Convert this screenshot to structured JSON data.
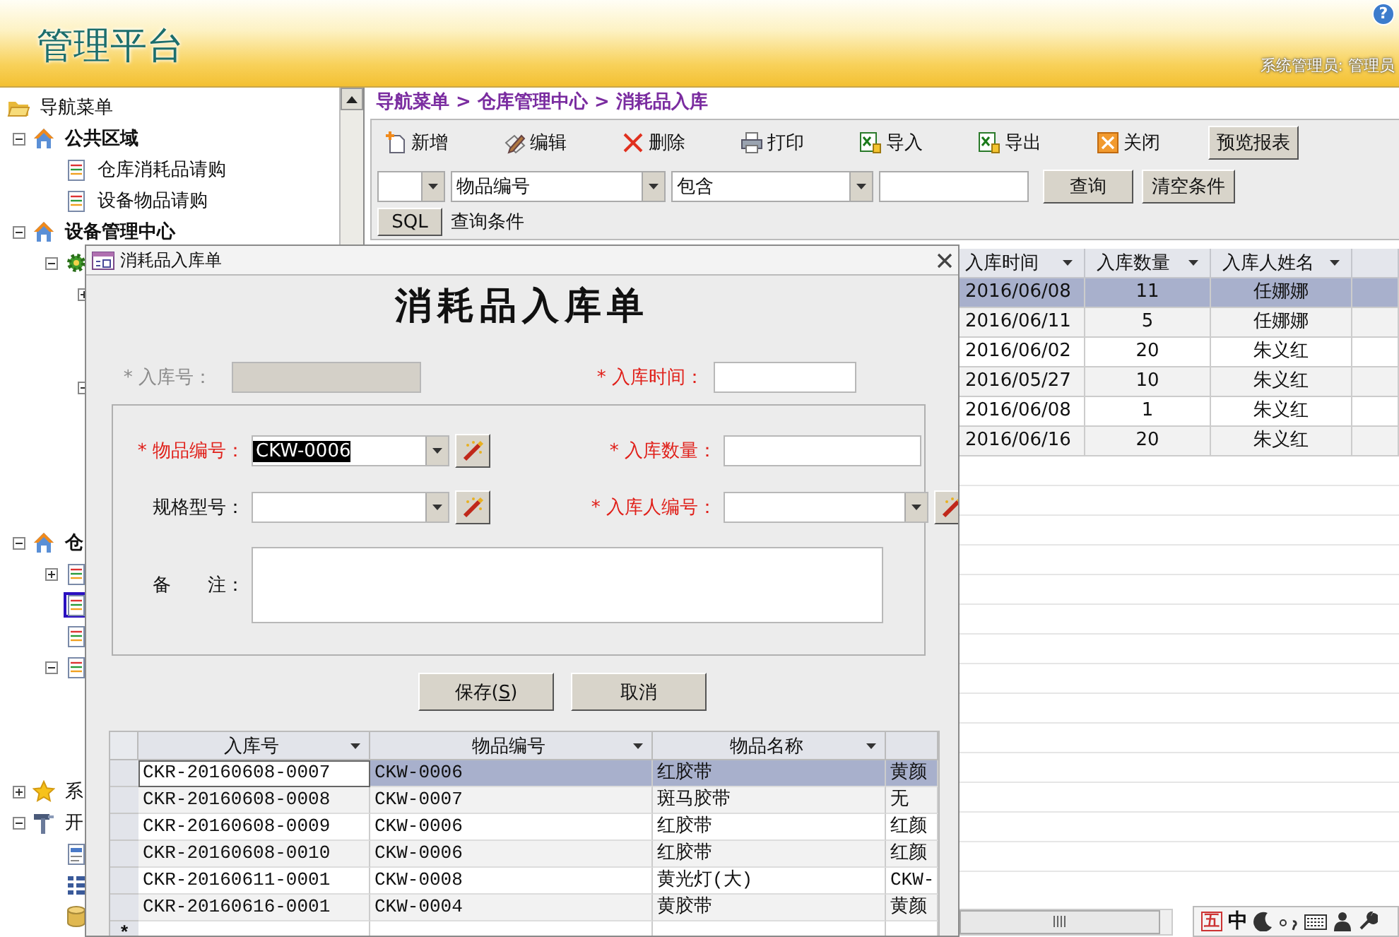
{
  "header": {
    "title": "管理平台",
    "user": "系统管理员: 管理员",
    "help": "?"
  },
  "nav_tree": {
    "root": {
      "label": "导航菜单",
      "kind": "folder",
      "selected": false,
      "children": [
        {
          "label": "公共区域",
          "kind": "area",
          "expanded": true,
          "selected": false,
          "children": [
            {
              "label": "仓库消耗品请购",
              "kind": "page",
              "selected": false
            },
            {
              "label": "设备物品请购",
              "kind": "page",
              "selected": false
            }
          ]
        },
        {
          "label": "设备管理中心",
          "kind": "area",
          "expanded": true,
          "selected": false,
          "children": [
            {
              "kind": "module",
              "expanded": true,
              "selected": false,
              "children": [
                {
                  "expanded": false,
                  "selected": false
                },
                {
                  "expanded": true,
                  "selected": false
                }
              ]
            }
          ]
        },
        {
          "label": "仓",
          "kind": "area",
          "expanded": true,
          "selected": false,
          "children": [
            {
              "kind": "page",
              "expanded": false,
              "selected": false
            },
            {
              "kind": "page",
              "selected": true
            },
            {
              "kind": "page",
              "selected": false
            },
            {
              "kind": "page",
              "expanded": true,
              "selected": false
            }
          ]
        },
        {
          "label": "系",
          "kind": "favorites",
          "expanded": false,
          "selected": false
        },
        {
          "label": "开",
          "kind": "tools",
          "expanded": true,
          "selected": false,
          "children": [
            {
              "kind": "form",
              "selected": false
            },
            {
              "kind": "list",
              "selected": false
            },
            {
              "kind": "database",
              "selected": false
            }
          ]
        }
      ]
    }
  },
  "breadcrumb": "导航菜单 > 仓库管理中心 > 消耗品入库",
  "toolbar": {
    "actions": [
      {
        "kind": "new",
        "label": "新增"
      },
      {
        "kind": "edit",
        "label": "编辑"
      },
      {
        "kind": "delete",
        "label": "删除"
      },
      {
        "kind": "print",
        "label": "打印"
      },
      {
        "kind": "import",
        "label": "导入"
      },
      {
        "kind": "export",
        "label": "导出"
      },
      {
        "kind": "close",
        "label": "关闭"
      }
    ],
    "report_button": "预览报表"
  },
  "filter": {
    "fields": [
      {
        "kind": "combo"
      },
      {
        "kind": "combo",
        "value": "物品编号"
      },
      {
        "kind": "combo",
        "value": "包含"
      },
      {
        "kind": "text"
      }
    ],
    "buttons": [
      "查询",
      "清空条件"
    ],
    "sql_button": "SQL",
    "condition_label": "查询条件"
  },
  "records": {
    "columns": [
      "入库时间",
      "入库数量",
      "入库人姓名"
    ],
    "rows": [
      {
        "selected": true,
        "cells": [
          "2016/06/08",
          "11",
          "任娜娜"
        ]
      },
      {
        "selected": false,
        "cells": [
          "2016/06/11",
          "5",
          "任娜娜"
        ]
      },
      {
        "selected": false,
        "cells": [
          "2016/06/02",
          "20",
          "朱义红"
        ]
      },
      {
        "selected": false,
        "cells": [
          "2016/05/27",
          "10",
          "朱义红"
        ]
      },
      {
        "selected": false,
        "cells": [
          "2016/06/08",
          "1",
          "朱义红"
        ]
      },
      {
        "selected": false,
        "cells": [
          "2016/06/16",
          "20",
          "朱义红"
        ]
      }
    ]
  },
  "ime_bar": {
    "mode": "五",
    "language": "中"
  },
  "dialog": {
    "title": "消耗品入库单",
    "heading": "消耗品入库单",
    "top_fields": [
      {
        "label": "* 入库号：",
        "required": true,
        "disabled": true
      },
      {
        "label": "* 入库时间：",
        "required": true,
        "disabled": false
      }
    ],
    "group_fields": [
      {
        "label": "* 物品编号：",
        "kind": "combo",
        "required": true,
        "disabled": false,
        "value": "CKW-0006",
        "value_selected": true,
        "picker": true
      },
      {
        "label": "* 入库数量：",
        "kind": "text",
        "required": true,
        "disabled": false,
        "picker": false
      },
      {
        "label": "规格型号：",
        "kind": "combo",
        "required": false,
        "disabled": false,
        "picker": true
      },
      {
        "label": "* 入库人编号：",
        "kind": "combo",
        "required": true,
        "disabled": false,
        "picker": true
      },
      {
        "label": "备　　注：",
        "kind": "memo",
        "required": false,
        "disabled": false,
        "picker": false
      }
    ],
    "buttons": [
      {
        "label": "保存(",
        "access_key": "S",
        "label_end": ")"
      },
      {
        "label": "取消"
      }
    ],
    "grid": {
      "columns": [
        "入库号",
        "物品编号",
        "物品名称"
      ],
      "rows": [
        {
          "selected": true,
          "first_cell_focused": true,
          "cells": [
            "CKR-20160608-0007",
            "CKW-0006",
            "红胶带",
            "黄颜"
          ]
        },
        {
          "selected": false,
          "first_cell_focused": false,
          "cells": [
            "CKR-20160608-0008",
            "CKW-0007",
            "斑马胶带",
            "无"
          ]
        },
        {
          "selected": false,
          "first_cell_focused": false,
          "cells": [
            "CKR-20160608-0009",
            "CKW-0006",
            "红胶带",
            "红颜"
          ]
        },
        {
          "selected": false,
          "first_cell_focused": false,
          "cells": [
            "CKR-20160608-0010",
            "CKW-0006",
            "红胶带",
            "红颜"
          ]
        },
        {
          "selected": false,
          "first_cell_focused": false,
          "cells": [
            "CKR-20160611-0001",
            "CKW-0008",
            "黄光灯(大)",
            "CKW-"
          ]
        },
        {
          "selected": false,
          "first_cell_focused": false,
          "cells": [
            "CKR-20160616-0001",
            "CKW-0004",
            "黄胶带",
            "黄颜"
          ]
        }
      ],
      "new_row_marker": "*"
    }
  }
}
